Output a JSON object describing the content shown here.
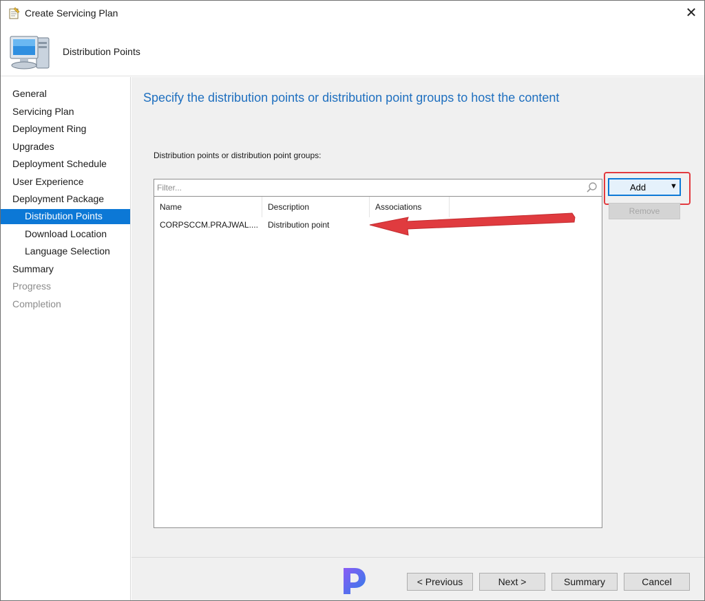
{
  "window": {
    "title": "Create Servicing Plan",
    "close_label": "✕"
  },
  "header": {
    "heading": "Distribution Points"
  },
  "sidebar": {
    "items": [
      {
        "label": "General"
      },
      {
        "label": "Servicing Plan"
      },
      {
        "label": "Deployment Ring"
      },
      {
        "label": "Upgrades"
      },
      {
        "label": "Deployment Schedule"
      },
      {
        "label": "User Experience"
      },
      {
        "label": "Deployment Package"
      },
      {
        "label": "Distribution Points",
        "active": true
      },
      {
        "label": "Download Location"
      },
      {
        "label": "Language Selection"
      },
      {
        "label": "Summary"
      },
      {
        "label": "Progress",
        "disabled": true
      },
      {
        "label": "Completion",
        "disabled": true
      }
    ]
  },
  "main": {
    "heading": "Specify the distribution points or distribution point groups to host the content",
    "list_label": "Distribution points or distribution point groups:",
    "filter_placeholder": "Filter...",
    "columns": [
      "Name",
      "Description",
      "Associations"
    ],
    "rows": [
      {
        "name": "CORPSCCM.PRAJWAL....",
        "description": "Distribution point",
        "associations": ""
      }
    ],
    "add_label": "Add",
    "add_caret": "▼",
    "remove_label": "Remove"
  },
  "footer": {
    "previous_label": "< Previous",
    "next_label": "Next >",
    "summary_label": "Summary",
    "cancel_label": "Cancel"
  },
  "colors": {
    "accent": "#0c78d6",
    "heading": "#1e6fbf",
    "highlight": "#e2393e"
  },
  "icons": [
    "wizard-icon",
    "computer-icon",
    "search-icon",
    "arrow-annotation",
    "brand-logo"
  ]
}
